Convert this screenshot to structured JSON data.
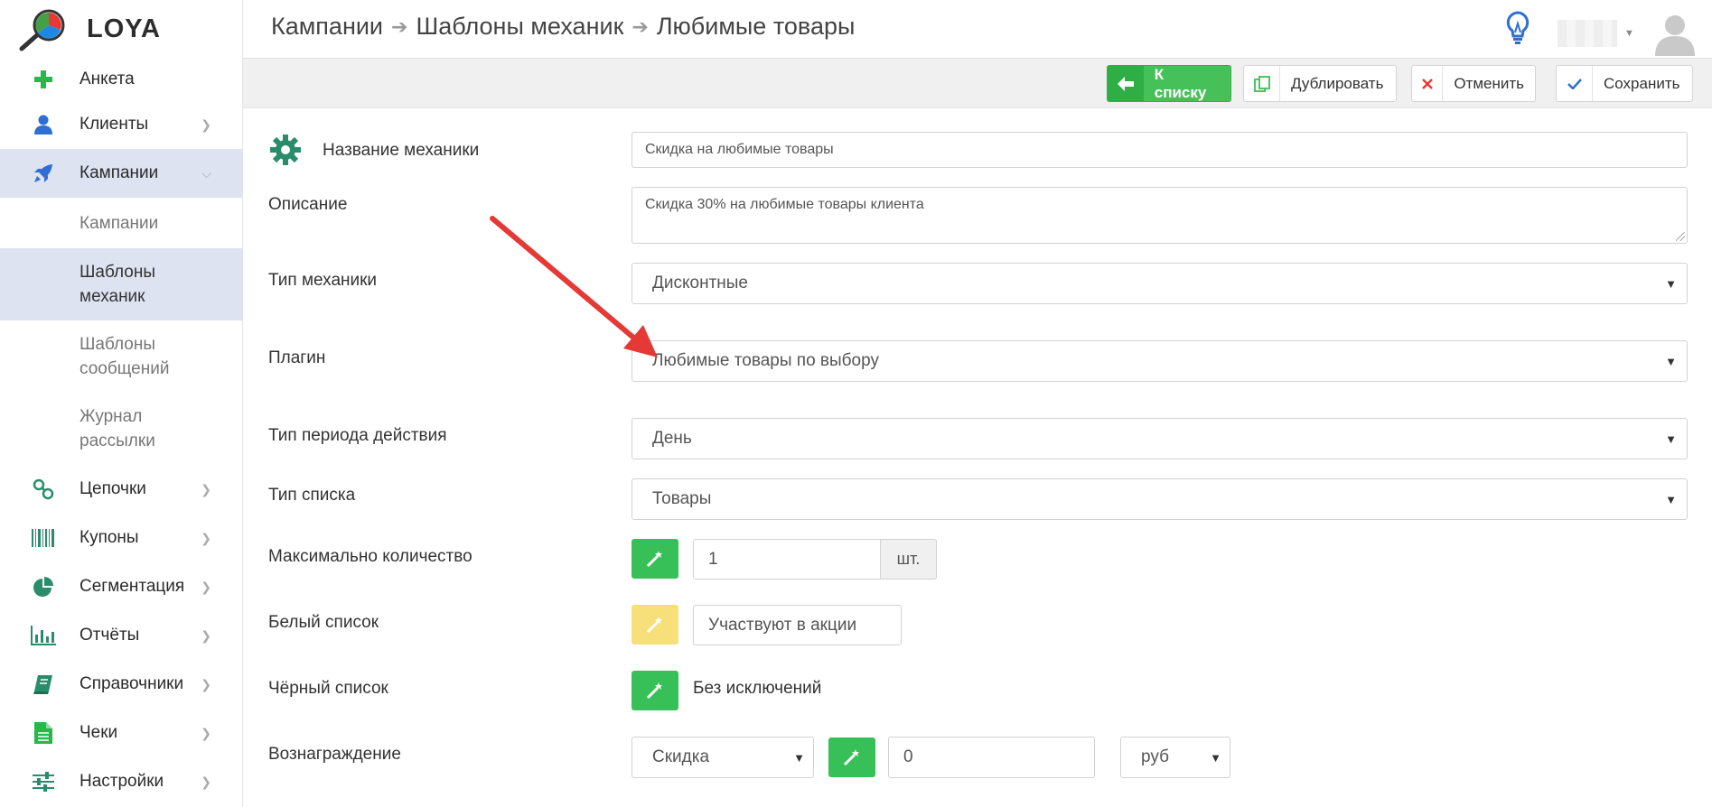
{
  "app": {
    "name": "LOYA"
  },
  "sidebar": {
    "items": [
      {
        "label": "Анкета",
        "icon": "plus-icon"
      },
      {
        "label": "Клиенты",
        "icon": "user-icon"
      },
      {
        "label": "Кампании",
        "icon": "rocket-icon"
      },
      {
        "label": "Цепочки",
        "icon": "link-icon"
      },
      {
        "label": "Купоны",
        "icon": "barcode-icon"
      },
      {
        "label": "Сегментация",
        "icon": "pie-chart-icon"
      },
      {
        "label": "Отчёты",
        "icon": "bar-chart-icon"
      },
      {
        "label": "Справочники",
        "icon": "book-icon"
      },
      {
        "label": "Чеки",
        "icon": "document-icon"
      },
      {
        "label": "Настройки",
        "icon": "sliders-icon"
      }
    ],
    "sub_items": [
      "Кампании",
      "Шаблоны механик",
      "Шаблоны сообщений",
      "Журнал рассылки"
    ],
    "sub_items_lines": [
      [
        "Кампании"
      ],
      [
        "Шаблоны",
        "механик"
      ],
      [
        "Шаблоны",
        "сообщений"
      ],
      [
        "Журнал",
        "рассылки"
      ]
    ]
  },
  "header": {
    "breadcrumb": [
      "Кампании",
      "Шаблоны механик",
      "Любимые товары"
    ]
  },
  "toolbar": {
    "back_label": "К списку",
    "duplicate_label": "Дублировать",
    "cancel_label": "Отменить",
    "save_label": "Сохранить"
  },
  "form": {
    "name_label": "Название механики",
    "name_value": "Скидка на любимые товары",
    "description_label": "Описание",
    "description_value": "Скидка 30% на любимые товары клиента",
    "type_label": "Тип механики",
    "type_value": "Дисконтные",
    "plugin_label": "Плагин",
    "plugin_value": "Любимые товары по выбору",
    "period_label": "Тип периода действия",
    "period_value": "День",
    "list_type_label": "Тип списка",
    "list_type_value": "Товары",
    "max_qty_label": "Максимально количество",
    "max_qty_value": "1",
    "max_qty_unit": "шт.",
    "whitelist_label": "Белый список",
    "whitelist_value": "Участвуют в акции",
    "blacklist_label": "Чёрный список",
    "blacklist_value": "Без исключений",
    "reward_label": "Вознаграждение",
    "reward_type_value": "Скидка",
    "reward_amount_value": "0",
    "reward_unit_value": "руб"
  },
  "colors": {
    "accent_green": "#38c058",
    "active_bg": "#dde3f1",
    "annotation_red": "#e53935",
    "icon_teal": "#2a8c6a"
  }
}
